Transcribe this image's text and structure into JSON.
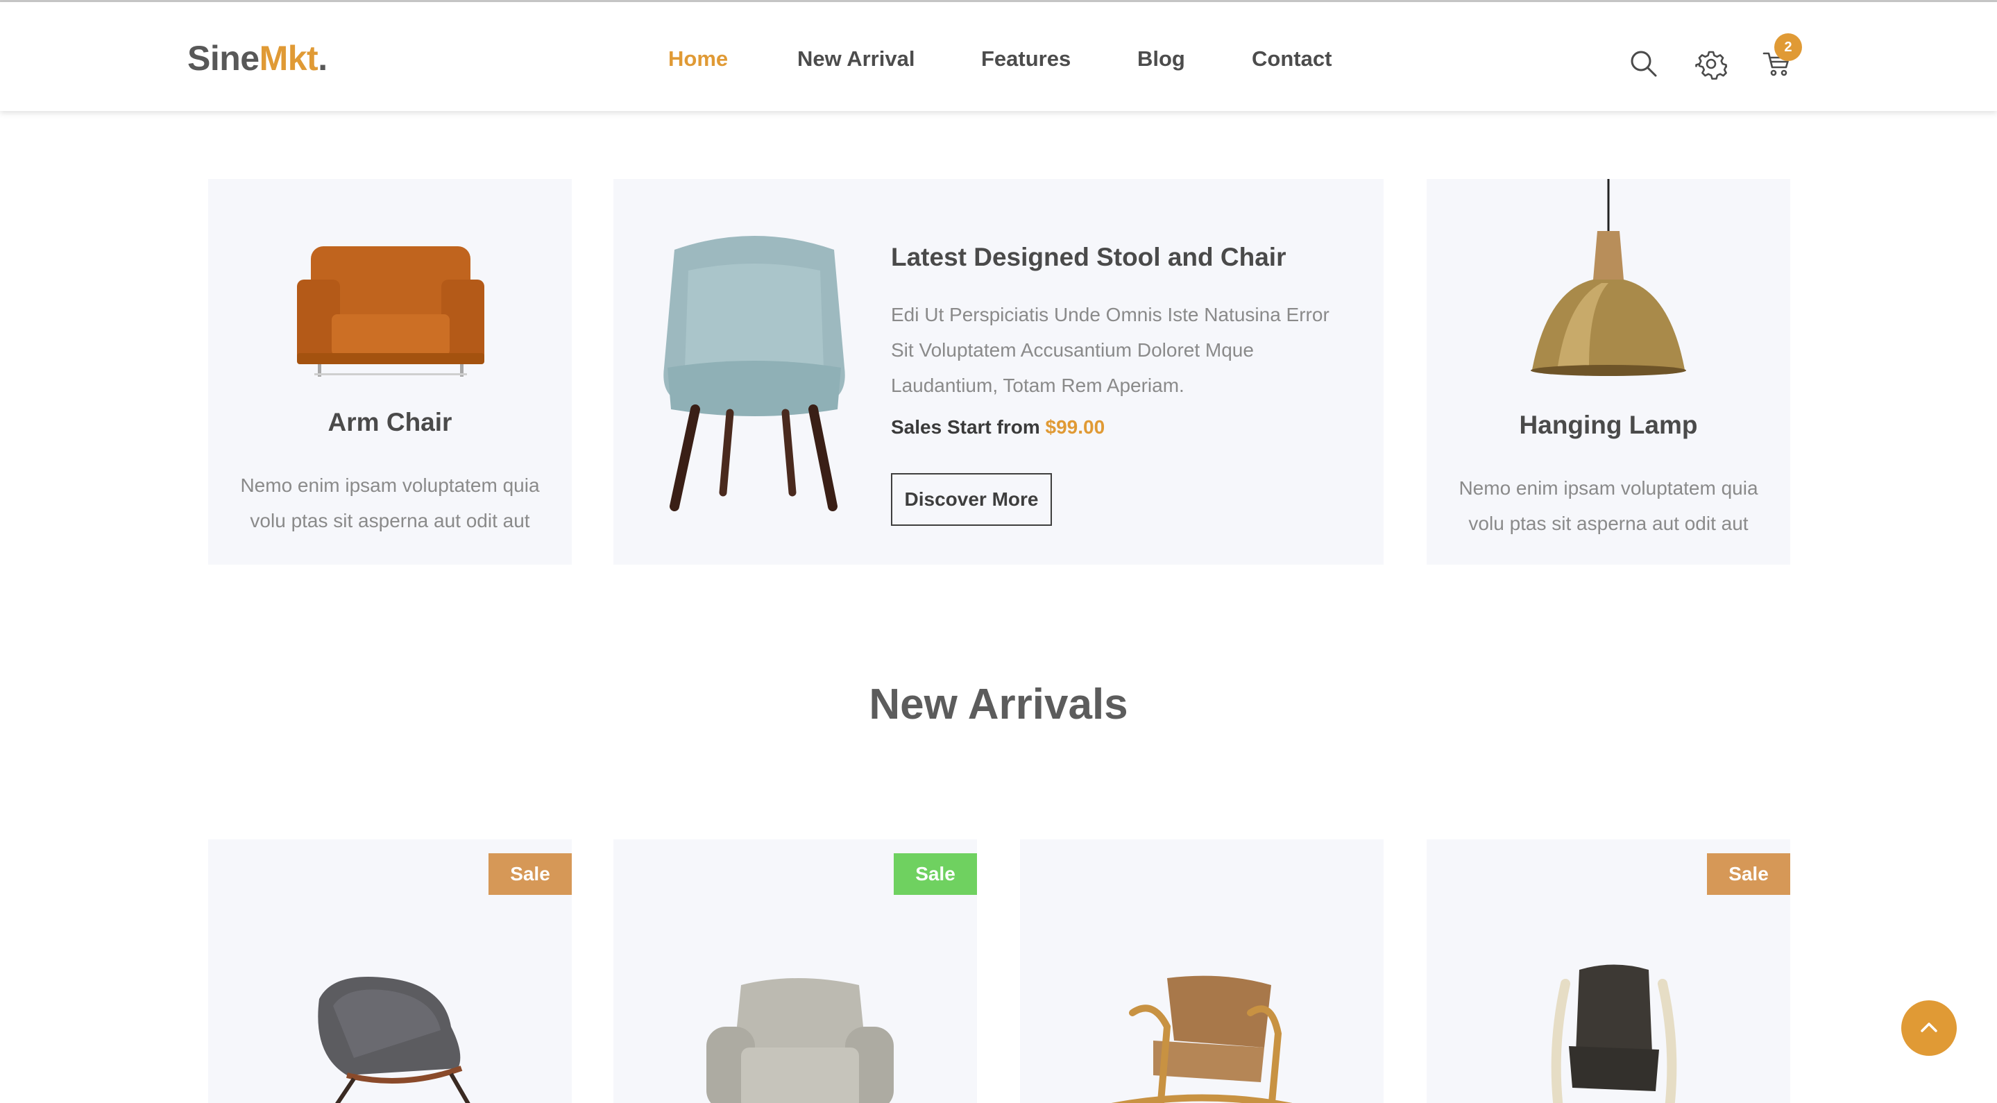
{
  "header": {
    "logo_main": "Sine",
    "logo_accent": "Mkt",
    "logo_dot": ".",
    "nav": [
      "Home",
      "New Arrival",
      "Features",
      "Blog",
      "Contact"
    ],
    "active_nav": "Home",
    "cart_count": "2",
    "icons": [
      "search-icon",
      "gear-icon",
      "cart-icon"
    ]
  },
  "features": {
    "arm_chair": {
      "title": "Arm Chair",
      "text": "Nemo enim ipsam voluptatem quia volu ptas sit asperna aut odit aut"
    },
    "promo": {
      "title": "Latest Designed Stool and Chair",
      "description": "Edi Ut Perspiciatis Unde Omnis Iste Natusina Error Sit Voluptatem Accusantium Doloret Mque Laudantium, Totam Rem Aperiam.",
      "price_label": "Sales Start from",
      "price": "$99.00",
      "button": "Discover More"
    },
    "hanging_lamp": {
      "title": "Hanging Lamp",
      "text": "Nemo enim ipsam voluptatem quia volu ptas sit asperna aut odit aut"
    }
  },
  "new_arrivals": {
    "title": "New Arrivals",
    "products": [
      {
        "badge": "Sale",
        "badge_color": "#d69857"
      },
      {
        "badge": "Sale",
        "badge_color": "#6fd160"
      },
      {
        "badge": "",
        "badge_color": ""
      },
      {
        "badge": "Sale",
        "badge_color": "#d69857"
      }
    ]
  },
  "colors": {
    "accent": "#e09a35",
    "card_bg": "#f6f7fb",
    "text_dark": "#4a4a4a",
    "text_muted": "#8a8a8a"
  }
}
